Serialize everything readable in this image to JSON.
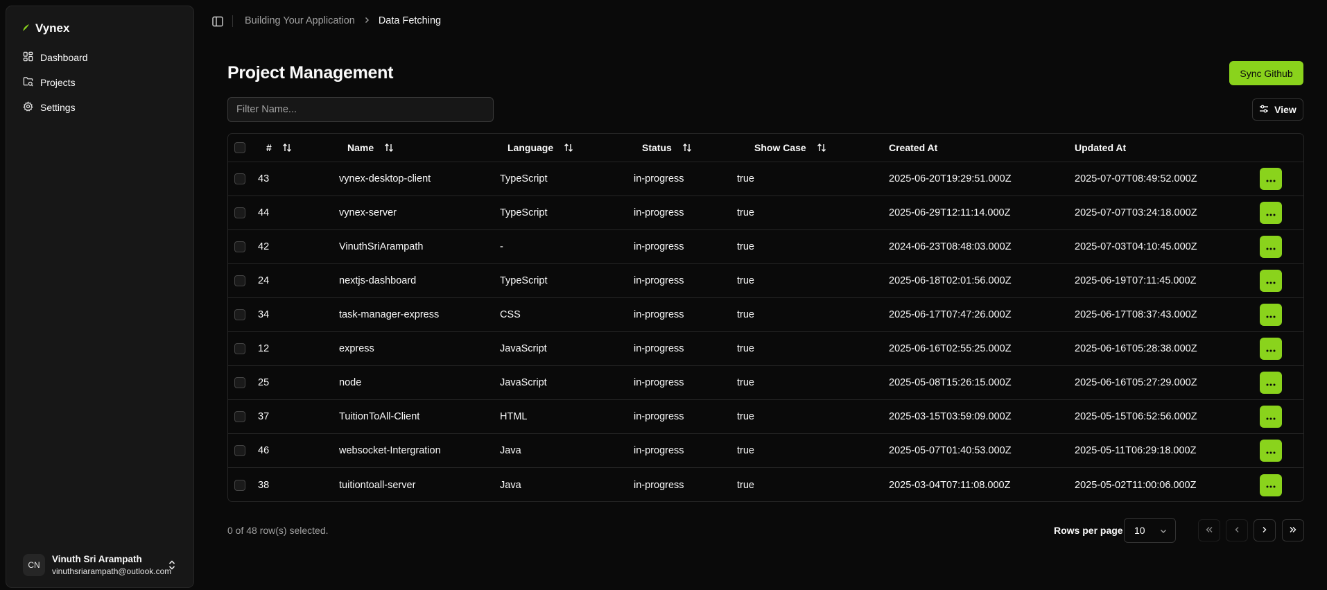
{
  "app": {
    "name": "Vynex"
  },
  "sidebar": {
    "items": [
      {
        "label": "Dashboard",
        "icon": "dashboard-icon"
      },
      {
        "label": "Projects",
        "icon": "folder-icon"
      },
      {
        "label": "Settings",
        "icon": "gear-icon"
      }
    ],
    "user": {
      "initials": "CN",
      "name": "Vinuth Sri Arampath",
      "email": "vinuthsriarampath@outlook.com"
    }
  },
  "breadcrumb": {
    "parent": "Building Your Application",
    "current": "Data Fetching"
  },
  "page": {
    "title": "Project Management",
    "sync_label": "Sync Github",
    "filter_placeholder": "Filter Name...",
    "view_label": "View"
  },
  "table": {
    "columns": [
      "#",
      "Name",
      "Language",
      "Status",
      "Show Case",
      "Created At",
      "Updated At"
    ],
    "rows": [
      [
        "43",
        "vynex-desktop-client",
        "TypeScript",
        "in-progress",
        "true",
        "2025-06-20T19:29:51.000Z",
        "2025-07-07T08:49:52.000Z"
      ],
      [
        "44",
        "vynex-server",
        "TypeScript",
        "in-progress",
        "true",
        "2025-06-29T12:11:14.000Z",
        "2025-07-07T03:24:18.000Z"
      ],
      [
        "42",
        "VinuthSriArampath",
        "-",
        "in-progress",
        "true",
        "2024-06-23T08:48:03.000Z",
        "2025-07-03T04:10:45.000Z"
      ],
      [
        "24",
        "nextjs-dashboard",
        "TypeScript",
        "in-progress",
        "true",
        "2025-06-18T02:01:56.000Z",
        "2025-06-19T07:11:45.000Z"
      ],
      [
        "34",
        "task-manager-express",
        "CSS",
        "in-progress",
        "true",
        "2025-06-17T07:47:26.000Z",
        "2025-06-17T08:37:43.000Z"
      ],
      [
        "12",
        "express",
        "JavaScript",
        "in-progress",
        "true",
        "2025-06-16T02:55:25.000Z",
        "2025-06-16T05:28:38.000Z"
      ],
      [
        "25",
        "node",
        "JavaScript",
        "in-progress",
        "true",
        "2025-05-08T15:26:15.000Z",
        "2025-06-16T05:27:29.000Z"
      ],
      [
        "37",
        "TuitionToAll-Client",
        "HTML",
        "in-progress",
        "true",
        "2025-03-15T03:59:09.000Z",
        "2025-05-15T06:52:56.000Z"
      ],
      [
        "46",
        "websocket-Intergration",
        "Java",
        "in-progress",
        "true",
        "2025-05-07T01:40:53.000Z",
        "2025-05-11T06:29:18.000Z"
      ],
      [
        "38",
        "tuitiontoall-server",
        "Java",
        "in-progress",
        "true",
        "2025-03-04T07:11:08.000Z",
        "2025-05-02T11:00:06.000Z"
      ]
    ]
  },
  "footer": {
    "selected_text": "0 of 48 row(s) selected.",
    "rows_per_page_label": "Rows per page",
    "rows_per_page_value": "10"
  },
  "colors": {
    "accent": "#8ad31c",
    "background": "#0a0a0a",
    "sidebar": "#171717",
    "border": "#262626"
  }
}
